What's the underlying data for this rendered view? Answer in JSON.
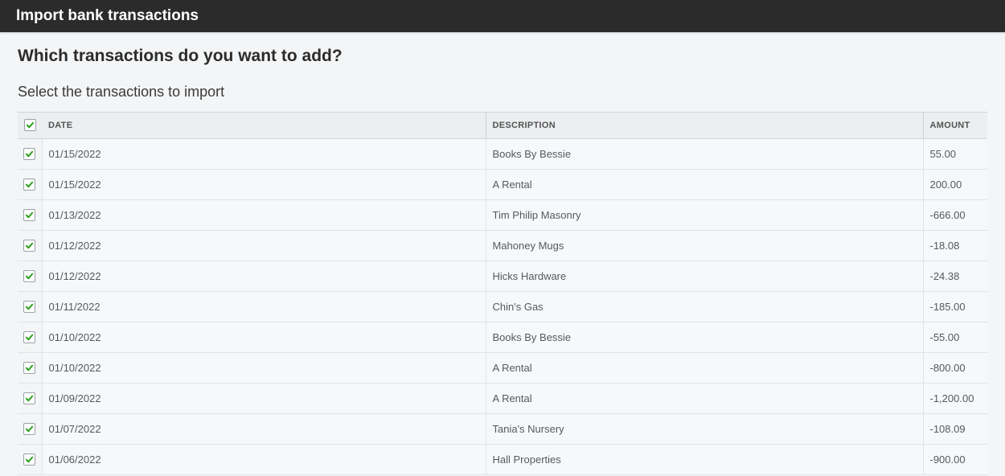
{
  "header": {
    "title": "Import bank transactions"
  },
  "page": {
    "question": "Which transactions do you want to add?",
    "subtitle": "Select the transactions to import"
  },
  "table": {
    "columns": {
      "date": "Date",
      "description": "Description",
      "amount": "Amount"
    },
    "rows": [
      {
        "date": "01/15/2022",
        "description": "Books By Bessie",
        "amount": "55.00"
      },
      {
        "date": "01/15/2022",
        "description": "A Rental",
        "amount": "200.00"
      },
      {
        "date": "01/13/2022",
        "description": "Tim Philip Masonry",
        "amount": "-666.00"
      },
      {
        "date": "01/12/2022",
        "description": "Mahoney Mugs",
        "amount": "-18.08"
      },
      {
        "date": "01/12/2022",
        "description": "Hicks Hardware",
        "amount": "-24.38"
      },
      {
        "date": "01/11/2022",
        "description": "Chin's Gas",
        "amount": "-185.00"
      },
      {
        "date": "01/10/2022",
        "description": "Books By Bessie",
        "amount": "-55.00"
      },
      {
        "date": "01/10/2022",
        "description": "A Rental",
        "amount": "-800.00"
      },
      {
        "date": "01/09/2022",
        "description": "A Rental",
        "amount": "-1,200.00"
      },
      {
        "date": "01/07/2022",
        "description": "Tania's Nursery",
        "amount": "-108.09"
      },
      {
        "date": "01/06/2022",
        "description": "Hall Properties",
        "amount": "-900.00"
      }
    ]
  }
}
